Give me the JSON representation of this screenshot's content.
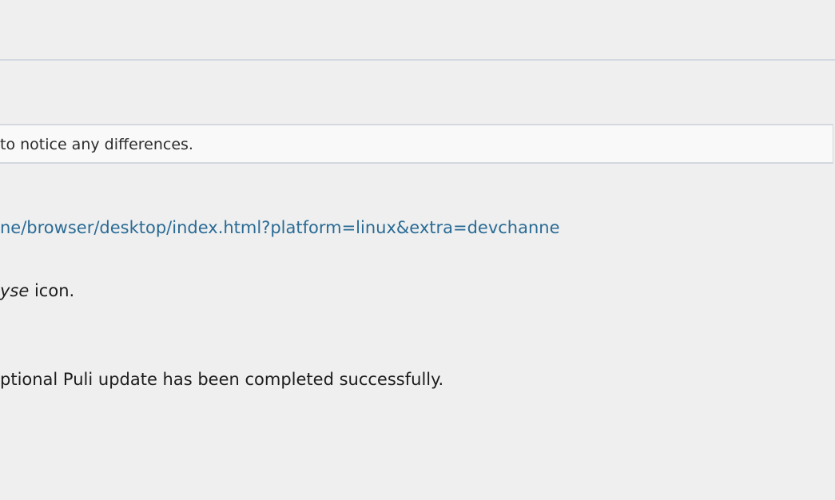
{
  "notice": {
    "text": "to notice any differences."
  },
  "steps": {
    "download_url": "ne/browser/desktop/index.html?platform=linux&extra=devchanne",
    "browse_icon": {
      "emphasis": "yse",
      "suffix": " icon."
    },
    "completion": "ptional Puli update has been completed successfully."
  },
  "colors": {
    "background": "#efefef",
    "notice_background": "#f9f9f9",
    "rule": "#d4d9e0",
    "link": "#2a6b95",
    "text": "#1c1c1c"
  }
}
